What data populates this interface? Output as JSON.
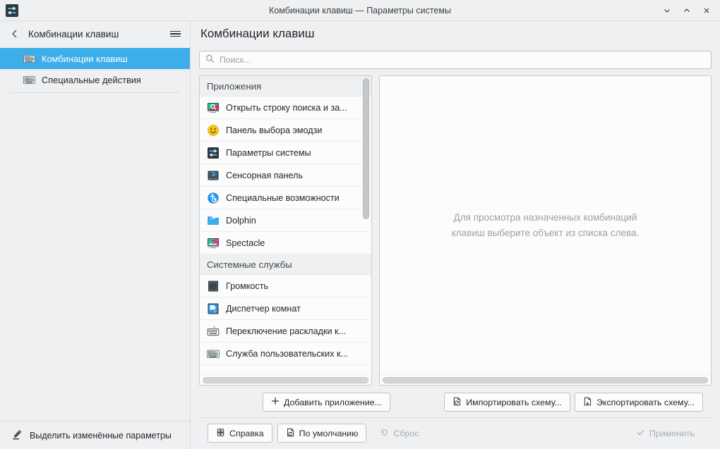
{
  "window": {
    "title": "Комбинации клавиш — Параметры системы",
    "app_icon": "system-settings-icon",
    "controls": {
      "minimize": "minimize-icon",
      "maximize": "maximize-icon",
      "close": "close-icon"
    }
  },
  "sidebar": {
    "back_label": "back-arrow-icon",
    "header_title": "Комбинации клавиш",
    "menu_label": "hamburger-menu-icon",
    "items": [
      {
        "label": "Комбинации клавиш",
        "icon": "keyboard-icon",
        "selected": true
      },
      {
        "label": "Специальные действия",
        "icon": "keyboard-icon",
        "selected": false
      }
    ],
    "footer": {
      "highlight_label": "Выделить изменённые параметры",
      "highlight_icon": "highlighter-pen-icon"
    }
  },
  "main": {
    "title": "Комбинации клавиш",
    "search": {
      "placeholder": "Поиск...",
      "value": "",
      "icon": "search-icon"
    },
    "list": {
      "groups": [
        {
          "title": "Приложения",
          "items": [
            {
              "label": "Открыть строку поиска и за...",
              "icon": "krunner-icon"
            },
            {
              "label": "Панель выбора эмодзи",
              "icon": "emoji-smiley-icon"
            },
            {
              "label": "Параметры системы",
              "icon": "system-settings-icon"
            },
            {
              "label": "Сенсорная панель",
              "icon": "touchpad-icon"
            },
            {
              "label": "Специальные возможности",
              "icon": "accessibility-icon"
            },
            {
              "label": "Dolphin",
              "icon": "folder-icon"
            },
            {
              "label": "Spectacle",
              "icon": "spectacle-icon"
            }
          ]
        },
        {
          "title": "Системные службы",
          "items": [
            {
              "label": "Громкость",
              "icon": "speaker-icon"
            },
            {
              "label": "Диспетчер комнат",
              "icon": "room-manager-icon"
            },
            {
              "label": "Переключение раскладки к...",
              "icon": "keyboard-layout-icon"
            },
            {
              "label": "Служба пользовательских к...",
              "icon": "keyboard-icon"
            }
          ]
        }
      ]
    },
    "detail": {
      "empty_message_line1": "Для просмотра назначенных комбинаций",
      "empty_message_line2": "клавиш выберите объект из списка слева."
    },
    "action_buttons": {
      "add_application": {
        "label": "Добавить приложение...",
        "icon": "plus-icon"
      },
      "import_scheme": {
        "label": "Импортировать схему...",
        "icon": "document-import-icon"
      },
      "export_scheme": {
        "label": "Экспортировать схему...",
        "icon": "document-export-icon"
      }
    },
    "footer_buttons": {
      "help": {
        "label": "Справка",
        "icon": "help-icon",
        "enabled": true
      },
      "defaults": {
        "label": "По умолчанию",
        "icon": "defaults-icon",
        "enabled": true
      },
      "reset": {
        "label": "Сброс",
        "icon": "reset-icon",
        "enabled": false
      },
      "apply": {
        "label": "Применить",
        "icon": "check-icon",
        "enabled": false
      }
    }
  },
  "colors": {
    "accent": "#3daee9",
    "window_bg": "#eff0f1",
    "view_bg": "#fcfcfc",
    "text": "#232629",
    "disabled_text": "#a8acaf"
  }
}
